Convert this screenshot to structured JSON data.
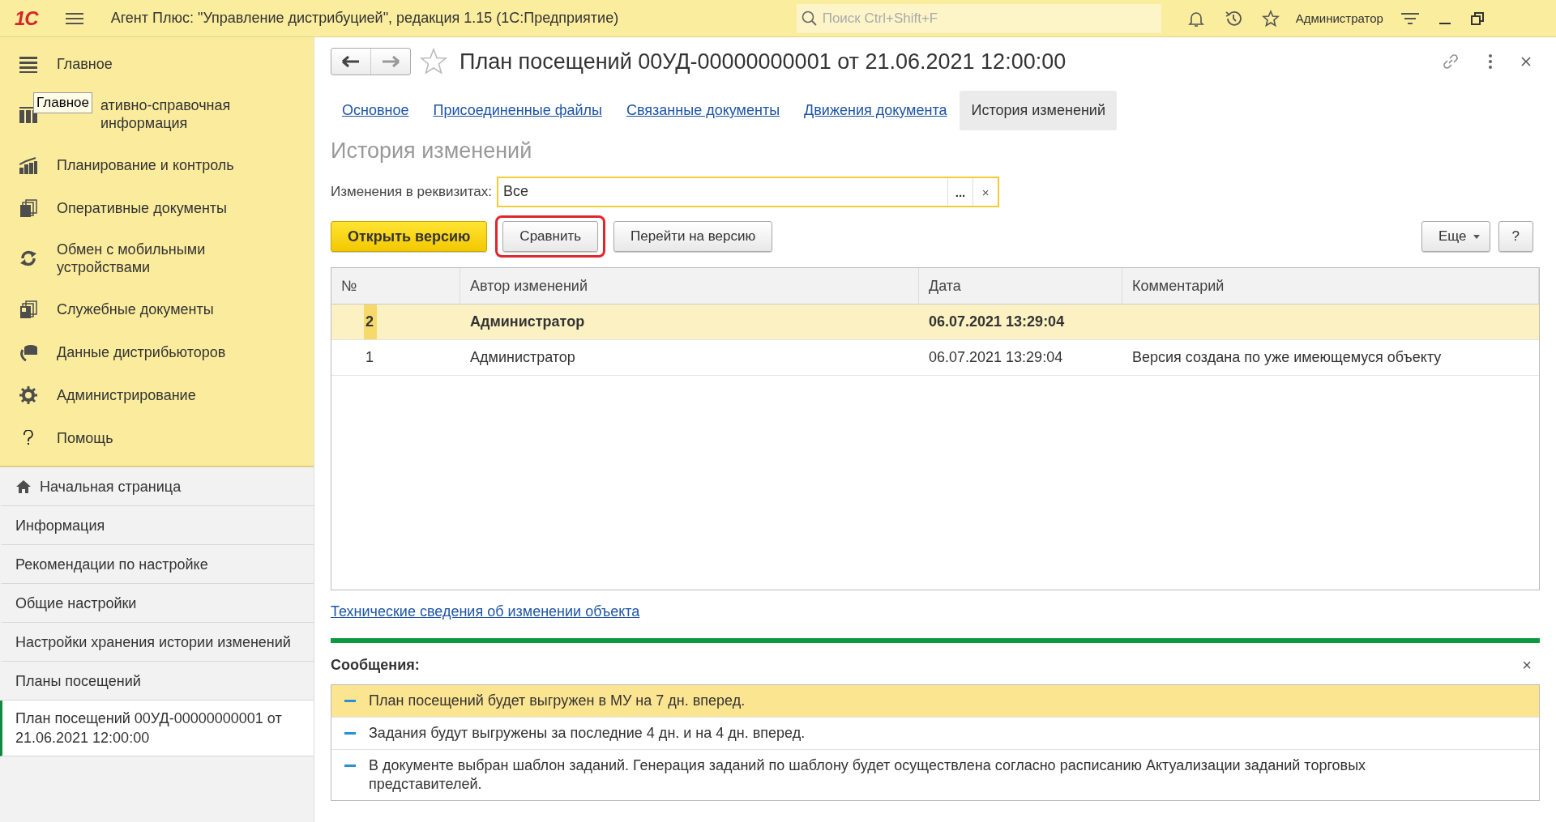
{
  "app_bar": {
    "logo": "1С",
    "title": "Агент Плюс: \"Управление дистрибуцией\", редакция 1.15  (1С:Предприятие)",
    "search": {
      "placeholder": "Поиск Ctrl+Shift+F"
    },
    "user": "Администратор"
  },
  "sections": [
    {
      "label": "Главное",
      "kind": "menu",
      "partly_hidden": false
    },
    {
      "label": "ативно-справочная информация",
      "kind": "books",
      "partly_hidden": true
    },
    {
      "label": "Планирование и контроль",
      "kind": "chart",
      "partly_hidden": false
    },
    {
      "label": "Оперативные документы",
      "kind": "docs",
      "partly_hidden": false
    },
    {
      "label": "Обмен с мобильными устройствами",
      "kind": "sync",
      "partly_hidden": false
    },
    {
      "label": "Служебные документы",
      "kind": "docs2",
      "partly_hidden": false
    },
    {
      "label": "Данные дистрибьюторов",
      "kind": "db",
      "partly_hidden": false
    },
    {
      "label": "Администрирование",
      "kind": "gear",
      "partly_hidden": false
    },
    {
      "label": "Помощь",
      "kind": "help",
      "partly_hidden": false
    }
  ],
  "tooltip": "Главное",
  "open_windows": [
    {
      "label": "Начальная страница",
      "home": true,
      "selected": false
    },
    {
      "label": "Информация",
      "home": false,
      "selected": false
    },
    {
      "label": "Рекомендации по настройке",
      "home": false,
      "selected": false
    },
    {
      "label": "Общие настройки",
      "home": false,
      "selected": false
    },
    {
      "label": "Настройки хранения истории изменений",
      "home": false,
      "selected": false
    },
    {
      "label": "Планы посещений",
      "home": false,
      "selected": false
    },
    {
      "label": "План посещений 00УД-00000000001 от 21.06.2021 12:00:00",
      "home": false,
      "selected": true
    }
  ],
  "form": {
    "title": "План посещений 00УД-00000000001 от 21.06.2021 12:00:00",
    "tabs": [
      {
        "label": "Основное",
        "selected": false
      },
      {
        "label": "Присоединенные файлы",
        "selected": false
      },
      {
        "label": "Связанные документы",
        "selected": false
      },
      {
        "label": "Движения документа",
        "selected": false
      },
      {
        "label": "История изменений",
        "selected": true
      }
    ],
    "heading": "История изменений",
    "filter": {
      "label": "Изменения в реквизитах:",
      "value": "Все",
      "select_button": "...",
      "clear_button": "×"
    },
    "buttons": [
      {
        "label": "Открыть версию",
        "kind": "primary",
        "highlighted": false
      },
      {
        "label": "Сравнить",
        "kind": "normal",
        "highlighted": true
      },
      {
        "label": "Перейти на версию",
        "kind": "normal",
        "highlighted": false
      }
    ],
    "more_button": "Еще",
    "help_button": "?",
    "table": {
      "columns": [
        "№",
        "Автор изменений",
        "Дата",
        "Комментарий"
      ],
      "rows": [
        {
          "cells": [
            "2",
            "Администратор",
            "06.07.2021 13:29:04",
            ""
          ],
          "selected": true
        },
        {
          "cells": [
            "1",
            "Администратор",
            "06.07.2021 13:29:04",
            "Версия создана по уже имеющемуся объекту"
          ],
          "selected": false
        }
      ]
    },
    "link": "Технические сведения об изменении объекта"
  },
  "messages": {
    "title": "Сообщения:",
    "close": "×",
    "items": [
      {
        "text": "План посещений будет выгружен в МУ на 7 дн. вперед.",
        "selected": true
      },
      {
        "text": "Задания будут выгружены за последние 4 дн. и на 4 дн. вперед.",
        "selected": false
      },
      {
        "text": "В документе выбран шаблон заданий. Генерация заданий по шаблону будет осуществлена согласно расписанию Актуализации заданий торговых представителей.",
        "selected": false
      }
    ]
  }
}
